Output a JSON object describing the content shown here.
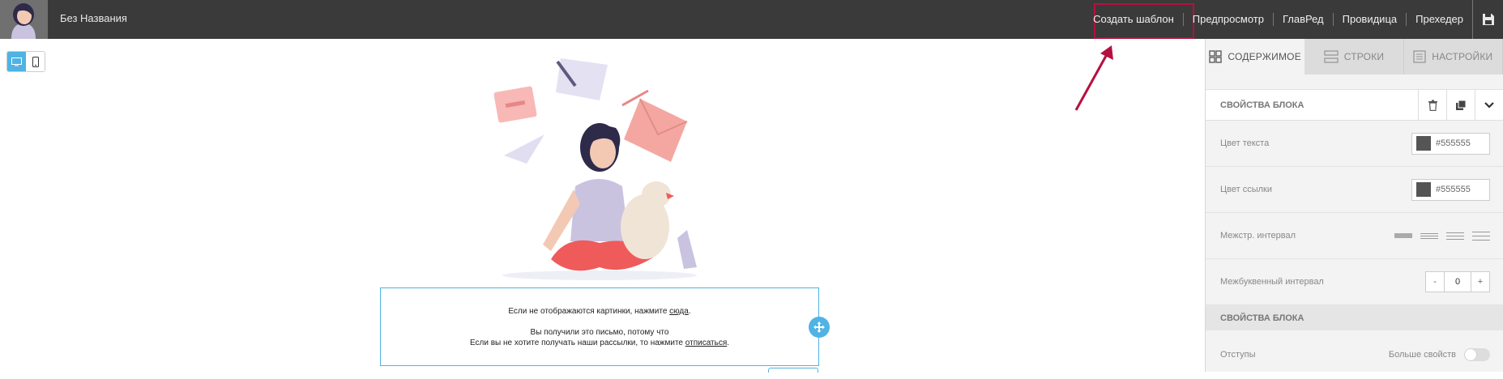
{
  "header": {
    "doc_title": "Без Названия",
    "menu": [
      "Создать шаблон",
      "Предпросмотр",
      "ГлавРед",
      "Провидица",
      "Прехедер"
    ],
    "highlight_color": "#b5103f"
  },
  "device_toggle": {
    "active": "desktop"
  },
  "email": {
    "line1_prefix": "Если не отображаются картинки, нажмите ",
    "line1_link": "сюда",
    "line1_suffix": ".",
    "line2": "Вы получили это письмо, потому что",
    "line3_prefix": "Если вы не хотите получать наши рассылки, то нажмите ",
    "line3_link": "отписаться",
    "line3_suffix": "."
  },
  "panel": {
    "tabs": [
      "СОДЕРЖИМОЕ",
      "СТРОКИ",
      "НАСТРОЙКИ"
    ],
    "active_tab": 0,
    "section1_title": "СВОЙСТВА БЛОКА",
    "text_color_label": "Цвет текста",
    "text_color_value": "#555555",
    "link_color_label": "Цвет ссылки",
    "link_color_value": "#555555",
    "line_height_label": "Межстр. интервал",
    "letter_spacing_label": "Межбуквенный интервал",
    "letter_spacing_value": "0",
    "stepper_minus": "-",
    "stepper_plus": "+",
    "section2_title": "СВОЙСТВА БЛОКА",
    "padding_label": "Отступы",
    "more_props_label": "Больше свойств",
    "accent_color": "#4fb3e4"
  }
}
